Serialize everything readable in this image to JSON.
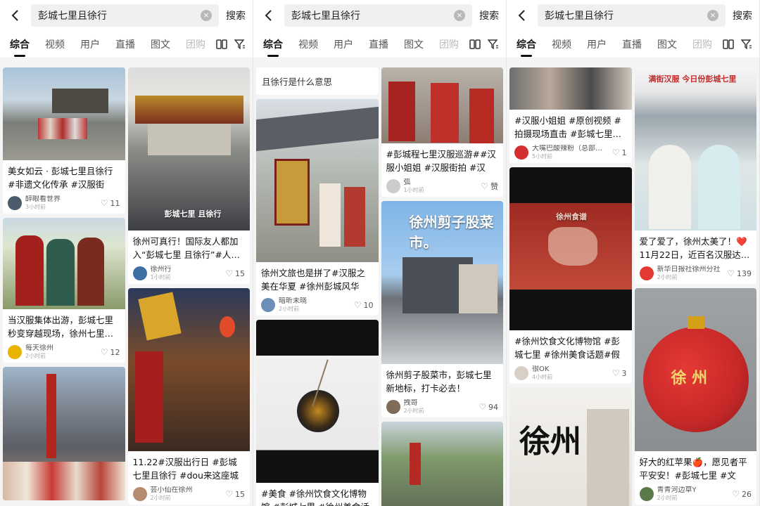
{
  "search": {
    "query": "彭城七里且徐行",
    "button": "搜索"
  },
  "tabs": [
    "综合",
    "视频",
    "用户",
    "直播",
    "图文",
    "团购"
  ],
  "screens": [
    {
      "left": [
        {
          "caption": "美女如云 · 彭城七里且徐行 #非遗文化传承 #汉服街拍…",
          "author": "醉眼看世界",
          "time": "3小时前",
          "likes": "11"
        },
        {
          "caption": "当汉服集体出游，彭城七里秒变穿越现场，徐州七里…",
          "author": "每天徐州",
          "time": "2小时前",
          "likes": "12"
        },
        {
          "caption": "",
          "author": "",
          "time": "",
          "likes": ""
        }
      ],
      "right": [
        {
          "overlay": "彭城七里 且徐行",
          "caption": "徐州可真行！国际友人都加入“彭城七里 且徐行”#人…",
          "author": "徐州行",
          "time": "1小时前",
          "likes": "15"
        },
        {
          "caption": "11.22#汉服出行日 #彭城七里且徐行 #dou来这座城 #…",
          "author": "芸小仙在徐州",
          "time": "2小时前",
          "likes": "15"
        }
      ]
    },
    {
      "suggest": "且徐行是什么意思",
      "left": [
        {
          "caption": "徐州文旅也是拼了#汉服之美在华夏 #徐州彭城风华",
          "author": "暗昕未晓",
          "time": "2小时前",
          "likes": "10"
        },
        {
          "caption": "#美食 #徐州饮食文化博物馆 #彭城七里 #徐州美食话题",
          "author": "",
          "time": "",
          "likes": ""
        }
      ],
      "right": [
        {
          "caption": "#彭城程七里汉服巡游##汉服小姐姐 #汉服街拍 #汉民…",
          "author": "弧",
          "time": "1小时前",
          "likes": "赞"
        },
        {
          "overlay": "徐州剪子股菜市。",
          "caption": "徐州剪子股菜市，彭城七里新地标，打卡必去！",
          "author": "拽哥",
          "time": "2小时前",
          "likes": "94"
        },
        {
          "caption": "",
          "author": "",
          "time": "",
          "likes": ""
        }
      ]
    },
    {
      "left": [
        {
          "caption": "#汉服小姐姐 #原创视频 #拍摄现场直击 #彭城七里…",
          "author": "大嘴巴酸辣粉（总部…",
          "time": "5小时前",
          "likes": "1"
        },
        {
          "overlay": "徐州食谱",
          "caption": "#徐州饮食文化博物馆 #彭城七里 #徐州美食话题#假期…",
          "author": "很OK",
          "time": "4小时前",
          "likes": "3"
        },
        {
          "overlay": "徐州",
          "caption": "",
          "author": "",
          "time": "",
          "likes": ""
        }
      ],
      "right": [
        {
          "overlay": "满街汉服 今日份彭城七里",
          "caption": "爱了爱了，徐州太美了！❤️ 11月22日，近百名汉服达…",
          "author": "新华日报社徐州分社",
          "time": "2小时前",
          "likes": "139"
        },
        {
          "overlay": "徐 州",
          "caption": "好大的红苹果🍎，愿见者平平安安！#彭城七里 #文庙…",
          "author": "青青河边草Y",
          "time": "2小时前",
          "likes": "26"
        }
      ]
    }
  ],
  "colors": {
    "accent": "#111111",
    "heart": "#e53935",
    "lantern": "#c62828"
  }
}
